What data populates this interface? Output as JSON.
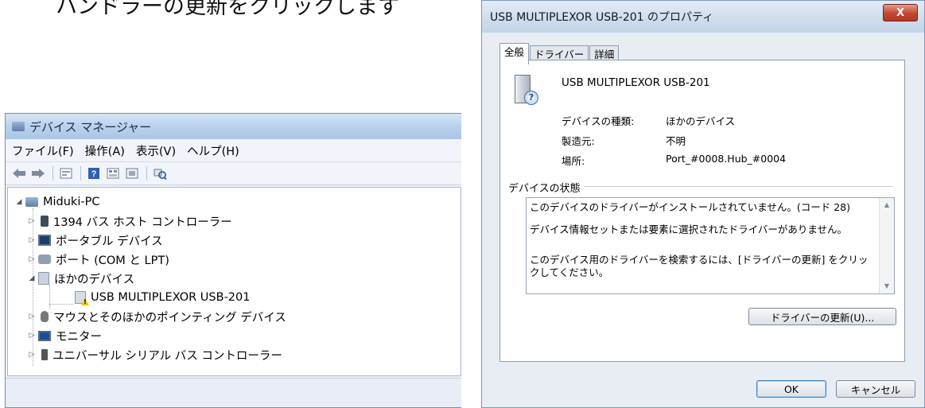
{
  "header_text": "ハンドラーの更新をクリックします",
  "device_manager": {
    "title": "デバイス マネージャー",
    "menus": [
      "ファイル(F)",
      "操作(A)",
      "表示(V)",
      "ヘルプ(H)"
    ],
    "toolbar_icons": [
      "back-arrow-icon",
      "forward-arrow-icon",
      "properties-icon",
      "help-icon",
      "view-icon",
      "update-icon",
      "scan-icon"
    ],
    "tree": {
      "root": "Miduki-PC",
      "items": [
        {
          "label": "1394 バス ホスト コントローラー",
          "icon": "chip-icon"
        },
        {
          "label": "ポータブル デバイス",
          "icon": "portable-device-icon"
        },
        {
          "label": "ポート (COM と LPT)",
          "icon": "port-icon"
        },
        {
          "label": "ほかのデバイス",
          "icon": "other-device-icon"
        },
        {
          "label": "USB MULTIPLEXOR USB-201",
          "icon": "warning-device-icon"
        },
        {
          "label": "マウスとそのほかのポインティング デバイス",
          "icon": "mouse-icon"
        },
        {
          "label": "モニター",
          "icon": "monitor-icon"
        },
        {
          "label": "ユニバーサル シリアル バス コントローラー",
          "icon": "usb-icon"
        }
      ]
    }
  },
  "properties_dialog": {
    "title": "USB MULTIPLEXOR USB-201 のプロパティ",
    "close_label": "X",
    "tabs": [
      "全般",
      "ドライバー",
      "詳細"
    ],
    "device_name": "USB MULTIPLEXOR USB-201",
    "properties": [
      {
        "label": "デバイスの種類:",
        "value": "ほかのデバイス"
      },
      {
        "label": "製造元:",
        "value": "不明"
      },
      {
        "label": "場所:",
        "value": "Port_#0008.Hub_#0004"
      }
    ],
    "status_group_label": "デバイスの状態",
    "status_lines": [
      "このデバイスのドライバーがインストールされていません。(コード 28)",
      "デバイス情報セットまたは要素に選択されたドライバーがありません。",
      "このデバイス用のドライバーを検索するには、[ドライバーの更新] をクリックしてください。"
    ],
    "update_button": "ドライバーの更新(U)...",
    "ok_button": "OK",
    "cancel_button": "キャンセル"
  }
}
